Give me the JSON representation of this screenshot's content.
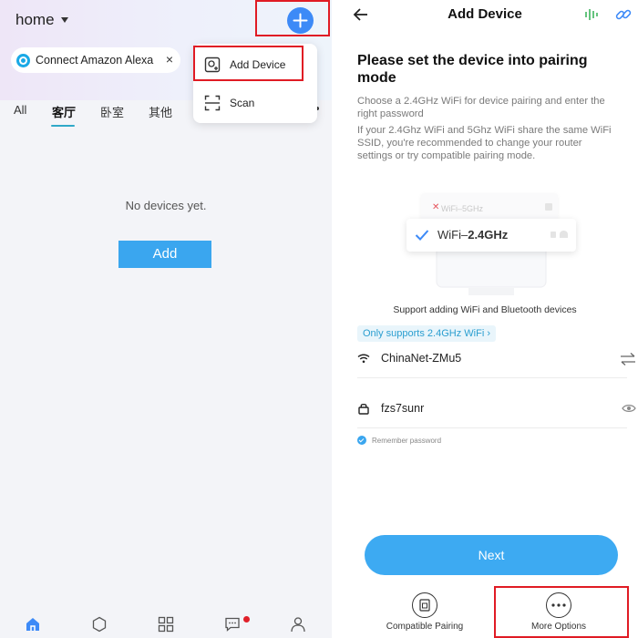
{
  "left": {
    "home_label": "home",
    "alexa_chip": {
      "label": "Connect Amazon Alexa",
      "close": "×"
    },
    "tabs": [
      {
        "label": "All"
      },
      {
        "label": "客厅"
      },
      {
        "label": "卧室"
      },
      {
        "label": "其他"
      }
    ],
    "active_tab": "客厅",
    "empty_message": "No devices yet.",
    "add_button": "Add",
    "popup": {
      "items": [
        {
          "label": "Add Device"
        },
        {
          "label": "Scan"
        }
      ]
    },
    "bottom_nav": [
      "home-icon",
      "hexagon-icon",
      "grid-icon",
      "message-icon",
      "profile-icon"
    ]
  },
  "right": {
    "title": "Add Device",
    "heading": "Please set the device into pairing mode",
    "desc1": "Choose a 2.4GHz WiFi for device pairing and enter the right password",
    "desc2": "If your 2.4Ghz WiFi and 5Ghz WiFi share the same WiFi SSID, you're recommended to change your router settings or try compatible pairing mode.",
    "illustration": {
      "wifi5": "WiFi–5GHz",
      "wifi24_prefix": "WiFi–",
      "wifi24_strong": "2.4GHz"
    },
    "support_text": "Support adding WiFi and Bluetooth devices",
    "only_badge": "Only supports 2.4GHz WiFi ›",
    "wifi_name": "ChinaNet-ZMu5",
    "password": "fzs7sunr",
    "remember": "Remember password",
    "next_button": "Next",
    "options": [
      {
        "label": "Compatible Pairing"
      },
      {
        "label": "More Options"
      }
    ]
  },
  "colors": {
    "accent": "#3d8af7",
    "button": "#3daaf2",
    "highlight_box": "#e01b24",
    "tab_underline": "#2fa8c8"
  }
}
